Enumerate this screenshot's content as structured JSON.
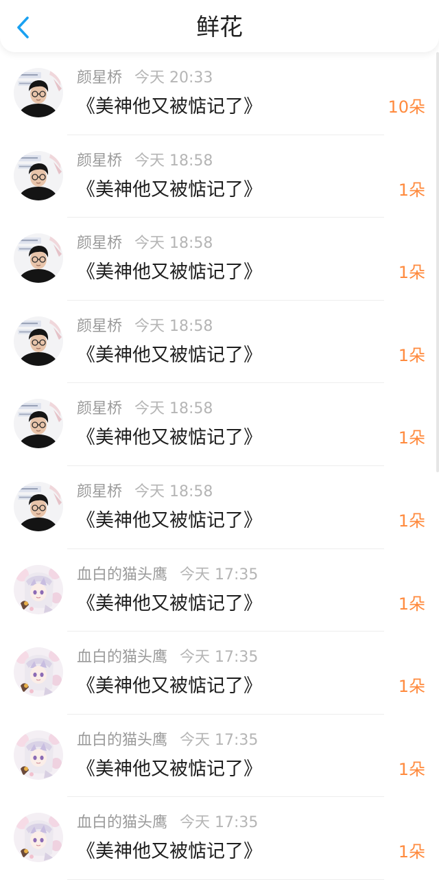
{
  "header": {
    "title": "鲜花",
    "back_icon": "chevron-left-icon",
    "accent_color": "#1aa1f1"
  },
  "colors": {
    "count": "#ff8a3d",
    "sender": "#9a9a9a",
    "time": "#b5b5b5"
  },
  "items": [
    {
      "sender": "颜星桥",
      "time": "今天 20:33",
      "title": "《美神他又被惦记了》",
      "count": "10朵",
      "avatar": "avatar-boy"
    },
    {
      "sender": "颜星桥",
      "time": "今天 18:58",
      "title": "《美神他又被惦记了》",
      "count": "1朵",
      "avatar": "avatar-boy"
    },
    {
      "sender": "颜星桥",
      "time": "今天 18:58",
      "title": "《美神他又被惦记了》",
      "count": "1朵",
      "avatar": "avatar-boy"
    },
    {
      "sender": "颜星桥",
      "time": "今天 18:58",
      "title": "《美神他又被惦记了》",
      "count": "1朵",
      "avatar": "avatar-boy"
    },
    {
      "sender": "颜星桥",
      "time": "今天 18:58",
      "title": "《美神他又被惦记了》",
      "count": "1朵",
      "avatar": "avatar-boy"
    },
    {
      "sender": "颜星桥",
      "time": "今天 18:58",
      "title": "《美神他又被惦记了》",
      "count": "1朵",
      "avatar": "avatar-boy"
    },
    {
      "sender": "血白的猫头鹰",
      "time": "今天 17:35",
      "title": "《美神他又被惦记了》",
      "count": "1朵",
      "avatar": "avatar-anime"
    },
    {
      "sender": "血白的猫头鹰",
      "time": "今天 17:35",
      "title": "《美神他又被惦记了》",
      "count": "1朵",
      "avatar": "avatar-anime"
    },
    {
      "sender": "血白的猫头鹰",
      "time": "今天 17:35",
      "title": "《美神他又被惦记了》",
      "count": "1朵",
      "avatar": "avatar-anime"
    },
    {
      "sender": "血白的猫头鹰",
      "time": "今天 17:35",
      "title": "《美神他又被惦记了》",
      "count": "1朵",
      "avatar": "avatar-anime"
    }
  ]
}
